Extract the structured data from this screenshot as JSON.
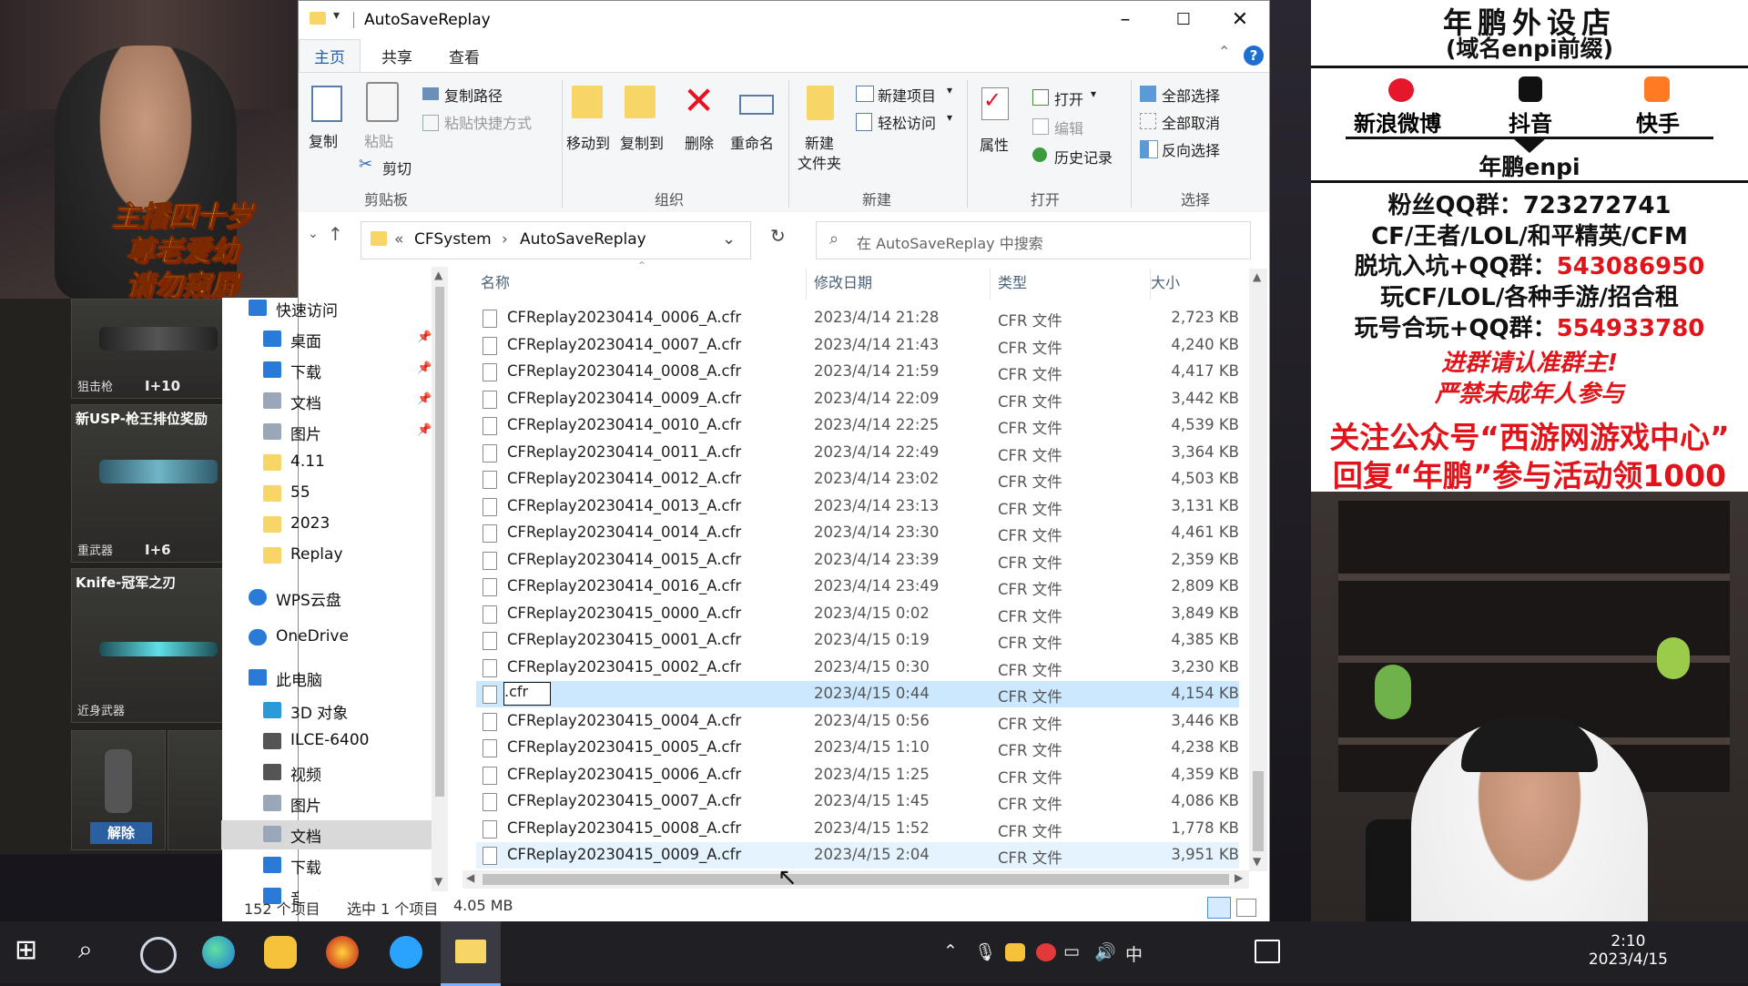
{
  "stream": {
    "caption_lines": [
      "主播四十岁",
      "尊老爱幼",
      "请勿窥屏"
    ],
    "game_cards": [
      {
        "title": "",
        "level": "狙击枪",
        "plus": "I+10"
      },
      {
        "title": "新USP-枪王排位奖励",
        "level": "重武器",
        "plus": "I+6"
      },
      {
        "title": "Knife-冠军之刃",
        "level": "近身武器",
        "plus": ""
      },
      {
        "title": "",
        "level": "",
        "plus": "",
        "button": "解除"
      }
    ],
    "overlay": {
      "shop_title": "年鹏外设店",
      "shop_sub": "(域名enpi前缀)",
      "platforms": [
        "新浪微博",
        "抖音",
        "快手"
      ],
      "handle": "年鹏enpi",
      "line1": "粉丝QQ群：723272741",
      "line2": "CF/王者/LOL/和平精英/CFM",
      "line3_prefix": "脱坑入坑+QQ群：",
      "line3_num": "543086950",
      "line4": "玩CF/LOL/各种手游/招合租",
      "line5_prefix": "玩号合玩+QQ群：",
      "line5_num": "554933780",
      "line6": "进群请认准群主!",
      "line7": "严禁未成年人参与",
      "line8": "关注公众号“西游网游戏中心”",
      "line9": "回复“年鹏”参与活动领1000"
    }
  },
  "explorer": {
    "title": "AutoSaveReplay",
    "menu": [
      "主页",
      "共享",
      "查看"
    ],
    "ribbon": {
      "clipboard": {
        "copy": "复制",
        "paste": "粘贴",
        "copy_path": "复制路径",
        "paste_shortcut": "粘贴快捷方式",
        "cut": "剪切",
        "group": "剪贴板"
      },
      "organize": {
        "move_to": "移动到",
        "copy_to": "复制到",
        "delete": "删除",
        "rename": "重命名",
        "group": "组织"
      },
      "new": {
        "new_folder_1": "新建",
        "new_folder_2": "文件夹",
        "new_item": "新建项目",
        "easy_access": "轻松访问",
        "group": "新建"
      },
      "open": {
        "properties": "属性",
        "open": "打开",
        "edit": "编辑",
        "history": "历史记录",
        "group": "打开"
      },
      "select": {
        "select_all": "全部选择",
        "select_none": "全部取消",
        "invert": "反向选择",
        "group": "选择"
      }
    },
    "address": {
      "prefix": "«",
      "crumb1": "CFSystem",
      "sep": "›",
      "crumb2": "AutoSaveReplay"
    },
    "search_placeholder": "在 AutoSaveReplay 中搜索",
    "nav": [
      {
        "label": "快速访问",
        "icon": "star-icon",
        "indent": 0,
        "pinned": false
      },
      {
        "label": "桌面",
        "icon": "desktop-icon",
        "indent": 1,
        "pinned": true
      },
      {
        "label": "下载",
        "icon": "download-icon",
        "indent": 1,
        "pinned": true
      },
      {
        "label": "文档",
        "icon": "document-icon",
        "indent": 1,
        "pinned": true
      },
      {
        "label": "图片",
        "icon": "pictures-icon",
        "indent": 1,
        "pinned": true
      },
      {
        "label": "4.11",
        "icon": "folder-icon",
        "indent": 1,
        "pinned": false
      },
      {
        "label": "55",
        "icon": "folder-icon",
        "indent": 1,
        "pinned": false
      },
      {
        "label": "2023",
        "icon": "folder-icon",
        "indent": 1,
        "pinned": false
      },
      {
        "label": "Replay",
        "icon": "folder-icon",
        "indent": 1,
        "pinned": false
      },
      {
        "label": "WPS云盘",
        "icon": "cloud-icon",
        "indent": 0,
        "pinned": false
      },
      {
        "label": "OneDrive",
        "icon": "cloud-icon",
        "indent": 0,
        "pinned": false
      },
      {
        "label": "此电脑",
        "icon": "computer-icon",
        "indent": 0,
        "pinned": false
      },
      {
        "label": "3D 对象",
        "icon": "cube-icon",
        "indent": 1,
        "pinned": false
      },
      {
        "label": "ILCE-6400",
        "icon": "camera-icon",
        "indent": 1,
        "pinned": false
      },
      {
        "label": "视频",
        "icon": "video-icon",
        "indent": 1,
        "pinned": false
      },
      {
        "label": "图片",
        "icon": "pictures-icon",
        "indent": 1,
        "pinned": false
      },
      {
        "label": "文档",
        "icon": "document-icon",
        "indent": 1,
        "pinned": false,
        "selected": true
      },
      {
        "label": "下载",
        "icon": "download-icon",
        "indent": 1,
        "pinned": false
      },
      {
        "label": "音乐",
        "icon": "music-icon",
        "indent": 1,
        "pinned": false
      }
    ],
    "columns": {
      "name": "名称",
      "date": "修改日期",
      "type": "类型",
      "size": "大小"
    },
    "files": [
      {
        "name": "CFReplay20230414_0006_A.cfr",
        "date": "2023/4/14 21:28",
        "type": "CFR 文件",
        "size": "2,723 KB"
      },
      {
        "name": "CFReplay20230414_0007_A.cfr",
        "date": "2023/4/14 21:43",
        "type": "CFR 文件",
        "size": "4,240 KB"
      },
      {
        "name": "CFReplay20230414_0008_A.cfr",
        "date": "2023/4/14 21:59",
        "type": "CFR 文件",
        "size": "4,417 KB"
      },
      {
        "name": "CFReplay20230414_0009_A.cfr",
        "date": "2023/4/14 22:09",
        "type": "CFR 文件",
        "size": "3,442 KB"
      },
      {
        "name": "CFReplay20230414_0010_A.cfr",
        "date": "2023/4/14 22:25",
        "type": "CFR 文件",
        "size": "4,539 KB"
      },
      {
        "name": "CFReplay20230414_0011_A.cfr",
        "date": "2023/4/14 22:49",
        "type": "CFR 文件",
        "size": "3,364 KB"
      },
      {
        "name": "CFReplay20230414_0012_A.cfr",
        "date": "2023/4/14 23:02",
        "type": "CFR 文件",
        "size": "4,503 KB"
      },
      {
        "name": "CFReplay20230414_0013_A.cfr",
        "date": "2023/4/14 23:13",
        "type": "CFR 文件",
        "size": "3,131 KB"
      },
      {
        "name": "CFReplay20230414_0014_A.cfr",
        "date": "2023/4/14 23:30",
        "type": "CFR 文件",
        "size": "4,461 KB"
      },
      {
        "name": "CFReplay20230414_0015_A.cfr",
        "date": "2023/4/14 23:39",
        "type": "CFR 文件",
        "size": "2,359 KB"
      },
      {
        "name": "CFReplay20230414_0016_A.cfr",
        "date": "2023/4/14 23:49",
        "type": "CFR 文件",
        "size": "2,809 KB"
      },
      {
        "name": "CFReplay20230415_0000_A.cfr",
        "date": "2023/4/15 0:02",
        "type": "CFR 文件",
        "size": "3,849 KB"
      },
      {
        "name": "CFReplay20230415_0001_A.cfr",
        "date": "2023/4/15 0:19",
        "type": "CFR 文件",
        "size": "4,385 KB"
      },
      {
        "name": "CFReplay20230415_0002_A.cfr",
        "date": "2023/4/15 0:30",
        "type": "CFR 文件",
        "size": "3,230 KB"
      },
      {
        "name": "",
        "rename_value": ".cfr",
        "date": "2023/4/15 0:44",
        "type": "CFR 文件",
        "size": "4,154 KB",
        "state": "selected"
      },
      {
        "name": "CFReplay20230415_0004_A.cfr",
        "date": "2023/4/15 0:56",
        "type": "CFR 文件",
        "size": "3,446 KB"
      },
      {
        "name": "CFReplay20230415_0005_A.cfr",
        "date": "2023/4/15 1:10",
        "type": "CFR 文件",
        "size": "4,238 KB"
      },
      {
        "name": "CFReplay20230415_0006_A.cfr",
        "date": "2023/4/15 1:25",
        "type": "CFR 文件",
        "size": "4,359 KB"
      },
      {
        "name": "CFReplay20230415_0007_A.cfr",
        "date": "2023/4/15 1:45",
        "type": "CFR 文件",
        "size": "4,086 KB"
      },
      {
        "name": "CFReplay20230415_0008_A.cfr",
        "date": "2023/4/15 1:52",
        "type": "CFR 文件",
        "size": "1,778 KB"
      },
      {
        "name": "CFReplay20230415_0009_A.cfr",
        "date": "2023/4/15 2:04",
        "type": "CFR 文件",
        "size": "3,951 KB",
        "state": "hover"
      }
    ],
    "status": {
      "count": "152 个项目",
      "selected": "选中 1 个项目",
      "size": "4.05 MB"
    }
  },
  "taskbar": {
    "ime": "中",
    "time": "2:10",
    "date": "2023/4/15"
  },
  "colors": {
    "selected_row": "#cce8ff",
    "hover_row": "#e5f3ff",
    "folder": "#f8d567",
    "accent": "#0078d7",
    "delete_red": "#e81123"
  }
}
